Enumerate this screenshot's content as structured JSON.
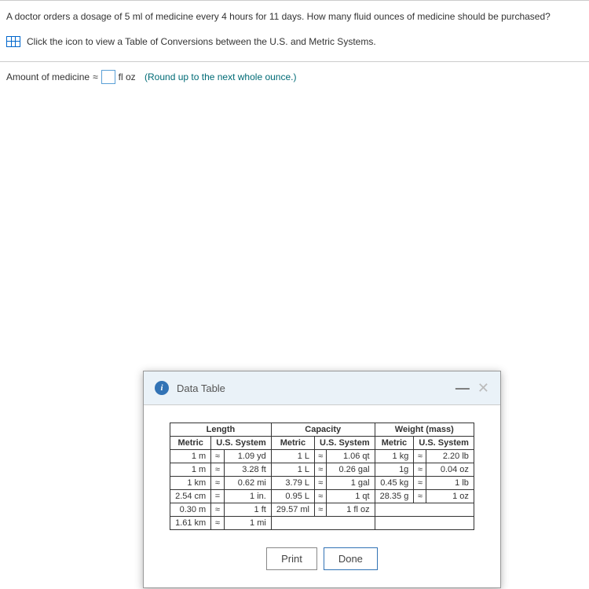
{
  "question": {
    "text": "A doctor orders a dosage of 5 ml of medicine every 4 hours for 11 days. How many fluid ounces of medicine should be purchased?",
    "hint": "Click the icon to view a Table of Conversions between the U.S. and Metric Systems.",
    "answer_label_prefix": "Amount of medicine",
    "approx_symbol": "≈",
    "answer_unit": "fl oz",
    "round_note": "(Round up to the next whole ounce.)"
  },
  "modal": {
    "title": "Data Table",
    "print_label": "Print",
    "done_label": "Done"
  },
  "table": {
    "sections": [
      "Length",
      "Capacity",
      "Weight (mass)"
    ],
    "subheaders": {
      "metric": "Metric",
      "us": "U.S. System"
    },
    "length": [
      {
        "metric": "1 m",
        "sym": "≈",
        "us": "1.09 yd"
      },
      {
        "metric": "1 m",
        "sym": "≈",
        "us": "3.28 ft"
      },
      {
        "metric": "1 km",
        "sym": "≈",
        "us": "0.62 mi"
      },
      {
        "metric": "2.54 cm",
        "sym": "=",
        "us": "1 in."
      },
      {
        "metric": "0.30 m",
        "sym": "≈",
        "us": "1 ft"
      },
      {
        "metric": "1.61 km",
        "sym": "≈",
        "us": "1 mi"
      }
    ],
    "capacity": [
      {
        "metric": "1 L",
        "sym": "≈",
        "us": "1.06 qt"
      },
      {
        "metric": "1 L",
        "sym": "≈",
        "us": "0.26 gal"
      },
      {
        "metric": "3.79 L",
        "sym": "≈",
        "us": "1 gal"
      },
      {
        "metric": "0.95 L",
        "sym": "≈",
        "us": "1 qt"
      },
      {
        "metric": "29.57 ml",
        "sym": "≈",
        "us": "1 fl oz"
      }
    ],
    "weight": [
      {
        "metric": "1 kg",
        "sym": "≈",
        "us": "2.20 lb"
      },
      {
        "metric": "1g",
        "sym": "≈",
        "us": "0.04 oz"
      },
      {
        "metric": "0.45 kg",
        "sym": "≈",
        "us": "1 lb"
      },
      {
        "metric": "28.35 g",
        "sym": "≈",
        "us": "1 oz"
      }
    ]
  }
}
